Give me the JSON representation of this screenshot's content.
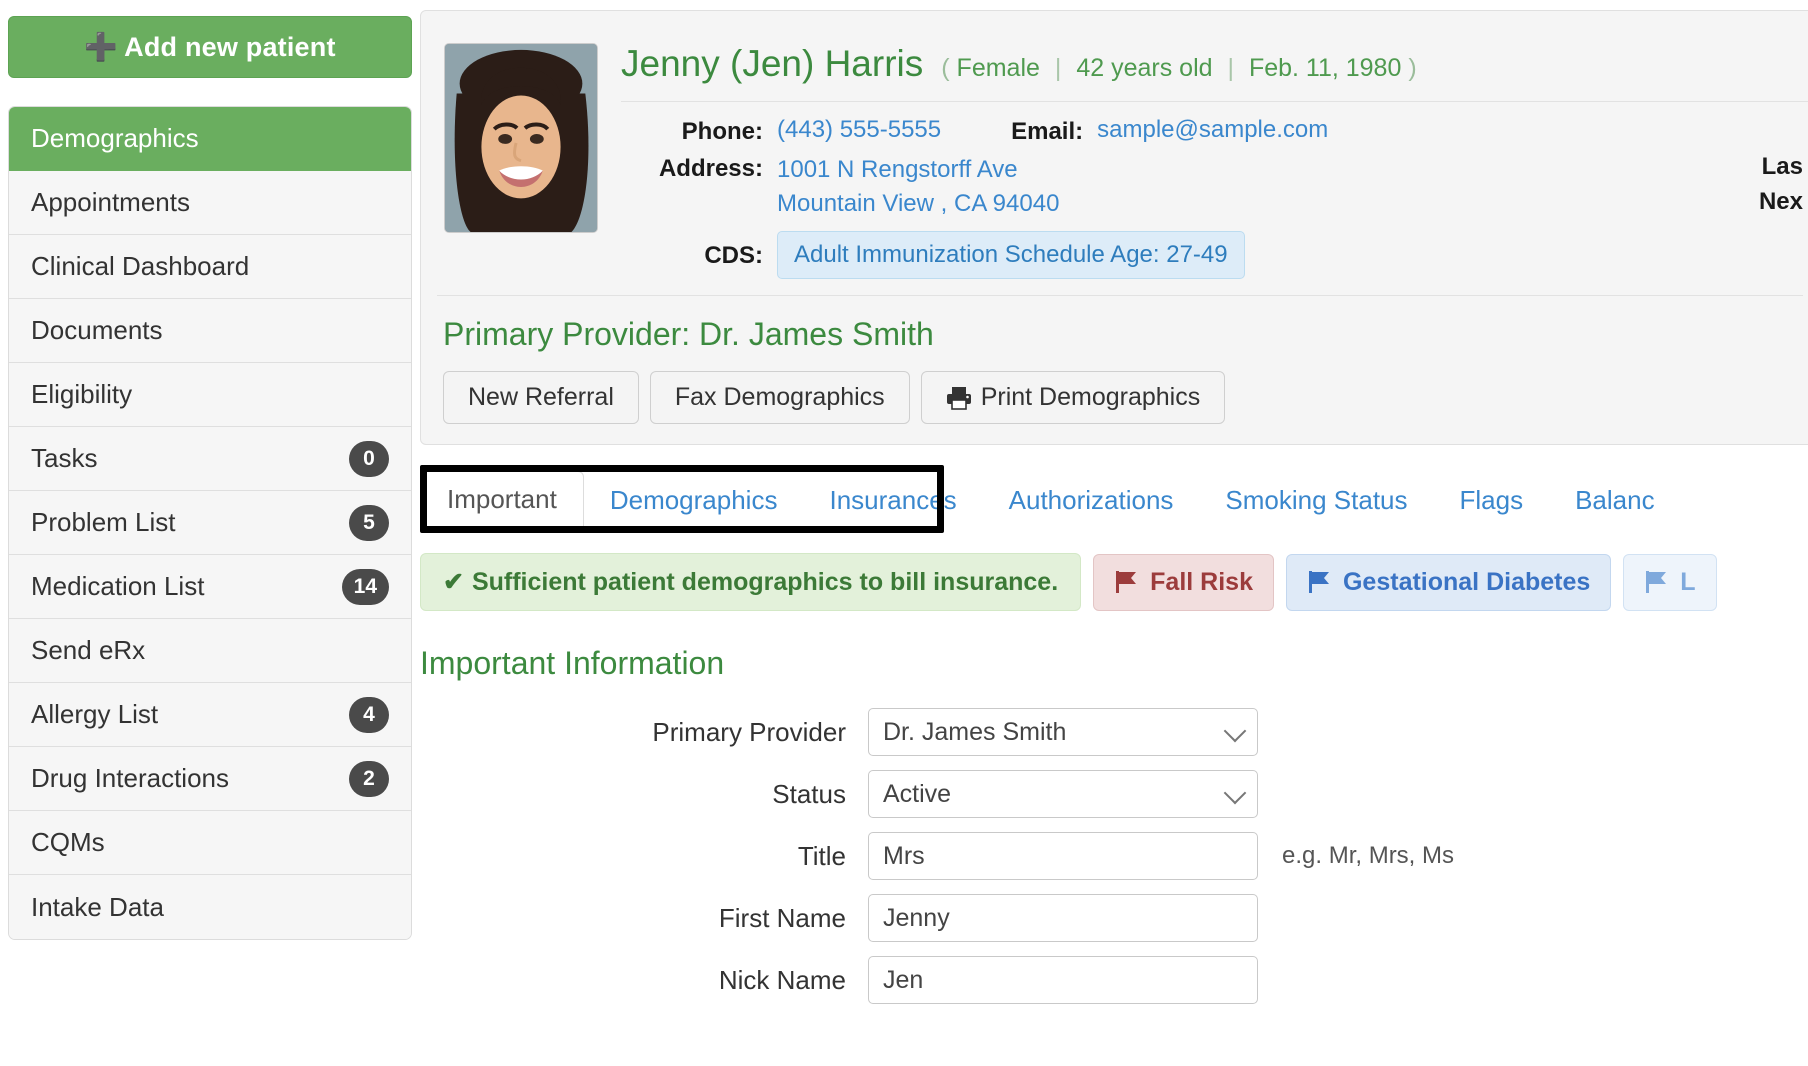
{
  "sidebar": {
    "add_patient_label": "Add new patient",
    "add_patient_icon": "plus-icon",
    "items": [
      {
        "label": "Demographics",
        "badge": "",
        "active": true
      },
      {
        "label": "Appointments",
        "badge": "",
        "active": false
      },
      {
        "label": "Clinical Dashboard",
        "badge": "",
        "active": false
      },
      {
        "label": "Documents",
        "badge": "",
        "active": false
      },
      {
        "label": "Eligibility",
        "badge": "",
        "active": false
      },
      {
        "label": "Tasks",
        "badge": "0",
        "active": false
      },
      {
        "label": "Problem List",
        "badge": "5",
        "active": false
      },
      {
        "label": "Medication List",
        "badge": "14",
        "active": false
      },
      {
        "label": "Send eRx",
        "badge": "",
        "active": false
      },
      {
        "label": "Allergy List",
        "badge": "4",
        "active": false
      },
      {
        "label": "Drug Interactions",
        "badge": "2",
        "active": false
      },
      {
        "label": "CQMs",
        "badge": "",
        "active": false
      },
      {
        "label": "Intake Data",
        "badge": "",
        "active": false
      }
    ]
  },
  "patient": {
    "name": "Jenny (Jen) Harris",
    "meta_open": "(",
    "gender": "Female",
    "age": "42 years old",
    "dob": "Feb. 11, 1980",
    "meta_close": ")",
    "phone_label": "Phone:",
    "phone": "(443) 555-5555",
    "email_label": "Email:",
    "email": "sample@sample.com",
    "address_label": "Address:",
    "address_line1": "1001 N Rengstorff Ave",
    "address_line2": "Mountain View , CA 94040",
    "cds_label": "CDS:",
    "cds_value": "Adult Immunization Schedule Age: 27-49",
    "last_appt_label": "Las",
    "next_appt_label": "Nex",
    "provider_line": "Primary Provider: Dr. James Smith"
  },
  "actions": {
    "new_referral": "New Referral",
    "fax_demographics": "Fax Demographics",
    "print_demographics": "Print Demographics",
    "print_icon": "printer-icon"
  },
  "tabs": [
    {
      "label": "Important",
      "selected": true
    },
    {
      "label": "Demographics",
      "selected": false
    },
    {
      "label": "Insurances",
      "selected": false
    },
    {
      "label": "Authorizations",
      "selected": false
    },
    {
      "label": "Smoking Status",
      "selected": false
    },
    {
      "label": "Flags",
      "selected": false
    },
    {
      "label": "Balanc",
      "selected": false
    }
  ],
  "alerts": {
    "sufficient_demographics": "Sufficient patient demographics to bill insurance.",
    "check_icon": "check-icon",
    "flags": [
      {
        "label": "Fall Risk",
        "style": "red",
        "icon": "flag-icon"
      },
      {
        "label": "Gestational Diabetes",
        "style": "blue",
        "icon": "flag-icon"
      },
      {
        "label": "L",
        "style": "lightblue",
        "icon": "flag-icon"
      }
    ]
  },
  "form": {
    "section_title": "Important Information",
    "fields": [
      {
        "label": "Primary Provider",
        "value": "Dr. James Smith",
        "type": "select",
        "hint": ""
      },
      {
        "label": "Status",
        "value": "Active",
        "type": "select",
        "hint": ""
      },
      {
        "label": "Title",
        "value": "Mrs",
        "type": "text",
        "hint": "e.g. Mr, Mrs, Ms"
      },
      {
        "label": "First Name",
        "value": "Jenny",
        "type": "text",
        "hint": ""
      },
      {
        "label": "Nick Name",
        "value": "Jen",
        "type": "text",
        "hint": ""
      }
    ]
  },
  "colors": {
    "brand_green": "#6aae5f",
    "link_blue": "#3a87cd",
    "heading_green": "#3c8a3f",
    "badge_dark": "#4a4a4a"
  }
}
